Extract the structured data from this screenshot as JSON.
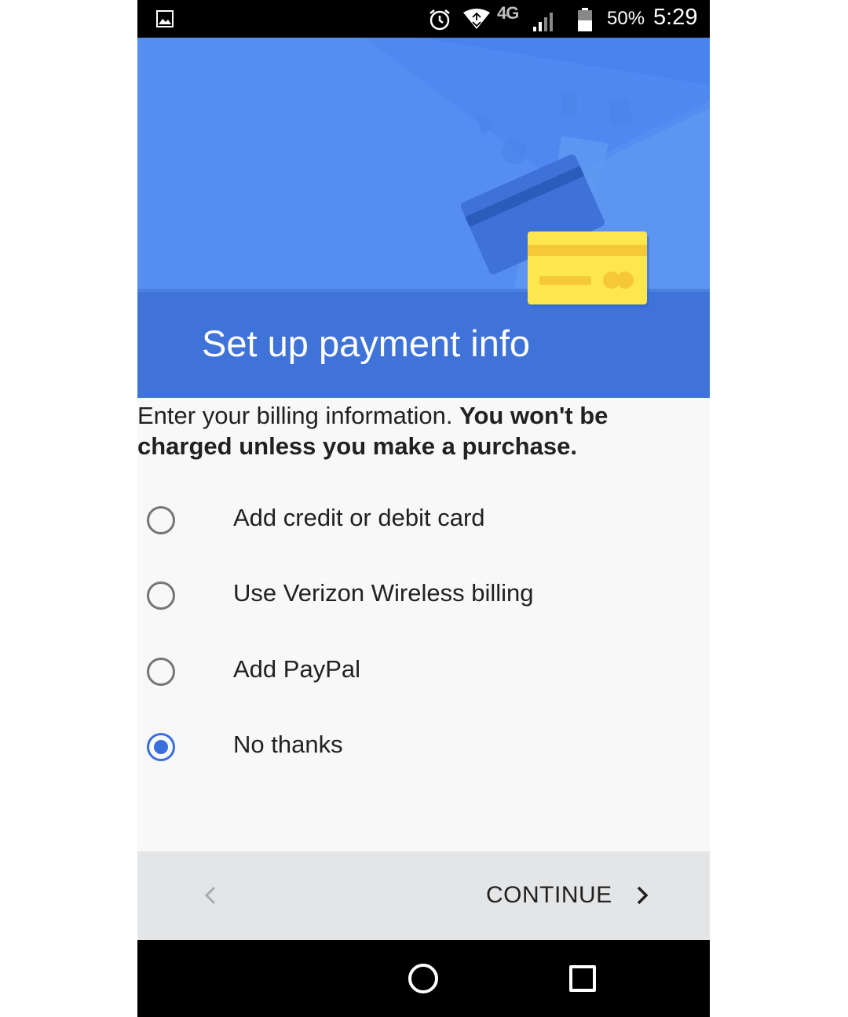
{
  "status_bar": {
    "network": "4G",
    "battery_percent": "50%",
    "time": "5:29",
    "icons": [
      "gallery-icon",
      "alarm-icon",
      "wifi-icon",
      "cell-signal-icon",
      "battery-icon"
    ]
  },
  "header": {
    "title": "Set up payment info"
  },
  "intro": {
    "text_regular": "Enter your billing information. ",
    "text_bold": "You won't be charged unless you make a purchase."
  },
  "options": [
    {
      "label": "Add credit or debit card",
      "selected": false
    },
    {
      "label": "Use Verizon Wireless billing",
      "selected": false
    },
    {
      "label": "Add PayPal",
      "selected": false
    },
    {
      "label": "No thanks",
      "selected": true
    }
  ],
  "actions": {
    "continue_label": "CONTINUE"
  },
  "colors": {
    "accent": "#3a6fdc",
    "header_blue": "#5a8ff0",
    "header_band": "#3f73d8",
    "card_yellow": "#fde74c"
  }
}
